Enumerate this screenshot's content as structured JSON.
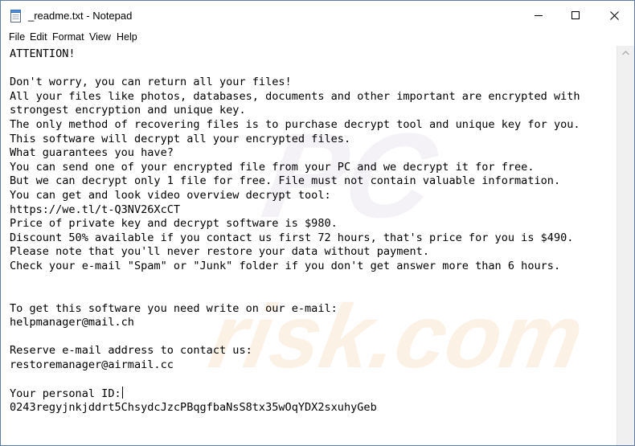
{
  "window": {
    "title": "_readme.txt - Notepad",
    "icon": "notepad-icon"
  },
  "title_buttons": {
    "minimize_icon": "minimize-icon",
    "maximize_icon": "maximize-icon",
    "close_icon": "close-icon"
  },
  "menu": {
    "items": [
      "File",
      "Edit",
      "Format",
      "View",
      "Help"
    ]
  },
  "editor": {
    "lines": [
      "ATTENTION!",
      "",
      "Don't worry, you can return all your files!",
      "All your files like photos, databases, documents and other important are encrypted with",
      "strongest encryption and unique key.",
      "The only method of recovering files is to purchase decrypt tool and unique key for you.",
      "This software will decrypt all your encrypted files.",
      "What guarantees you have?",
      "You can send one of your encrypted file from your PC and we decrypt it for free.",
      "But we can decrypt only 1 file for free. File must not contain valuable information.",
      "You can get and look video overview decrypt tool:",
      "https://we.tl/t-Q3NV26XcCT",
      "Price of private key and decrypt software is $980.",
      "Discount 50% available if you contact us first 72 hours, that's price for you is $490.",
      "Please note that you'll never restore your data without payment.",
      "Check your e-mail \"Spam\" or \"Junk\" folder if you don't get answer more than 6 hours.",
      "",
      "",
      "To get this software you need write on our e-mail:",
      "helpmanager@mail.ch",
      "",
      "Reserve e-mail address to contact us:",
      "restoremanager@airmail.cc",
      "",
      "Your personal ID:",
      "0243regyjnkjddrt5ChsydcJzcPBqgfbaNsS8tx35wOqYDX2sxuhyGeb"
    ],
    "caret_line": 24
  },
  "watermark": {
    "main": "PC",
    "sub": "risk.com"
  },
  "scrollbar": {
    "up_icon": "scroll-up-arrow-icon"
  }
}
